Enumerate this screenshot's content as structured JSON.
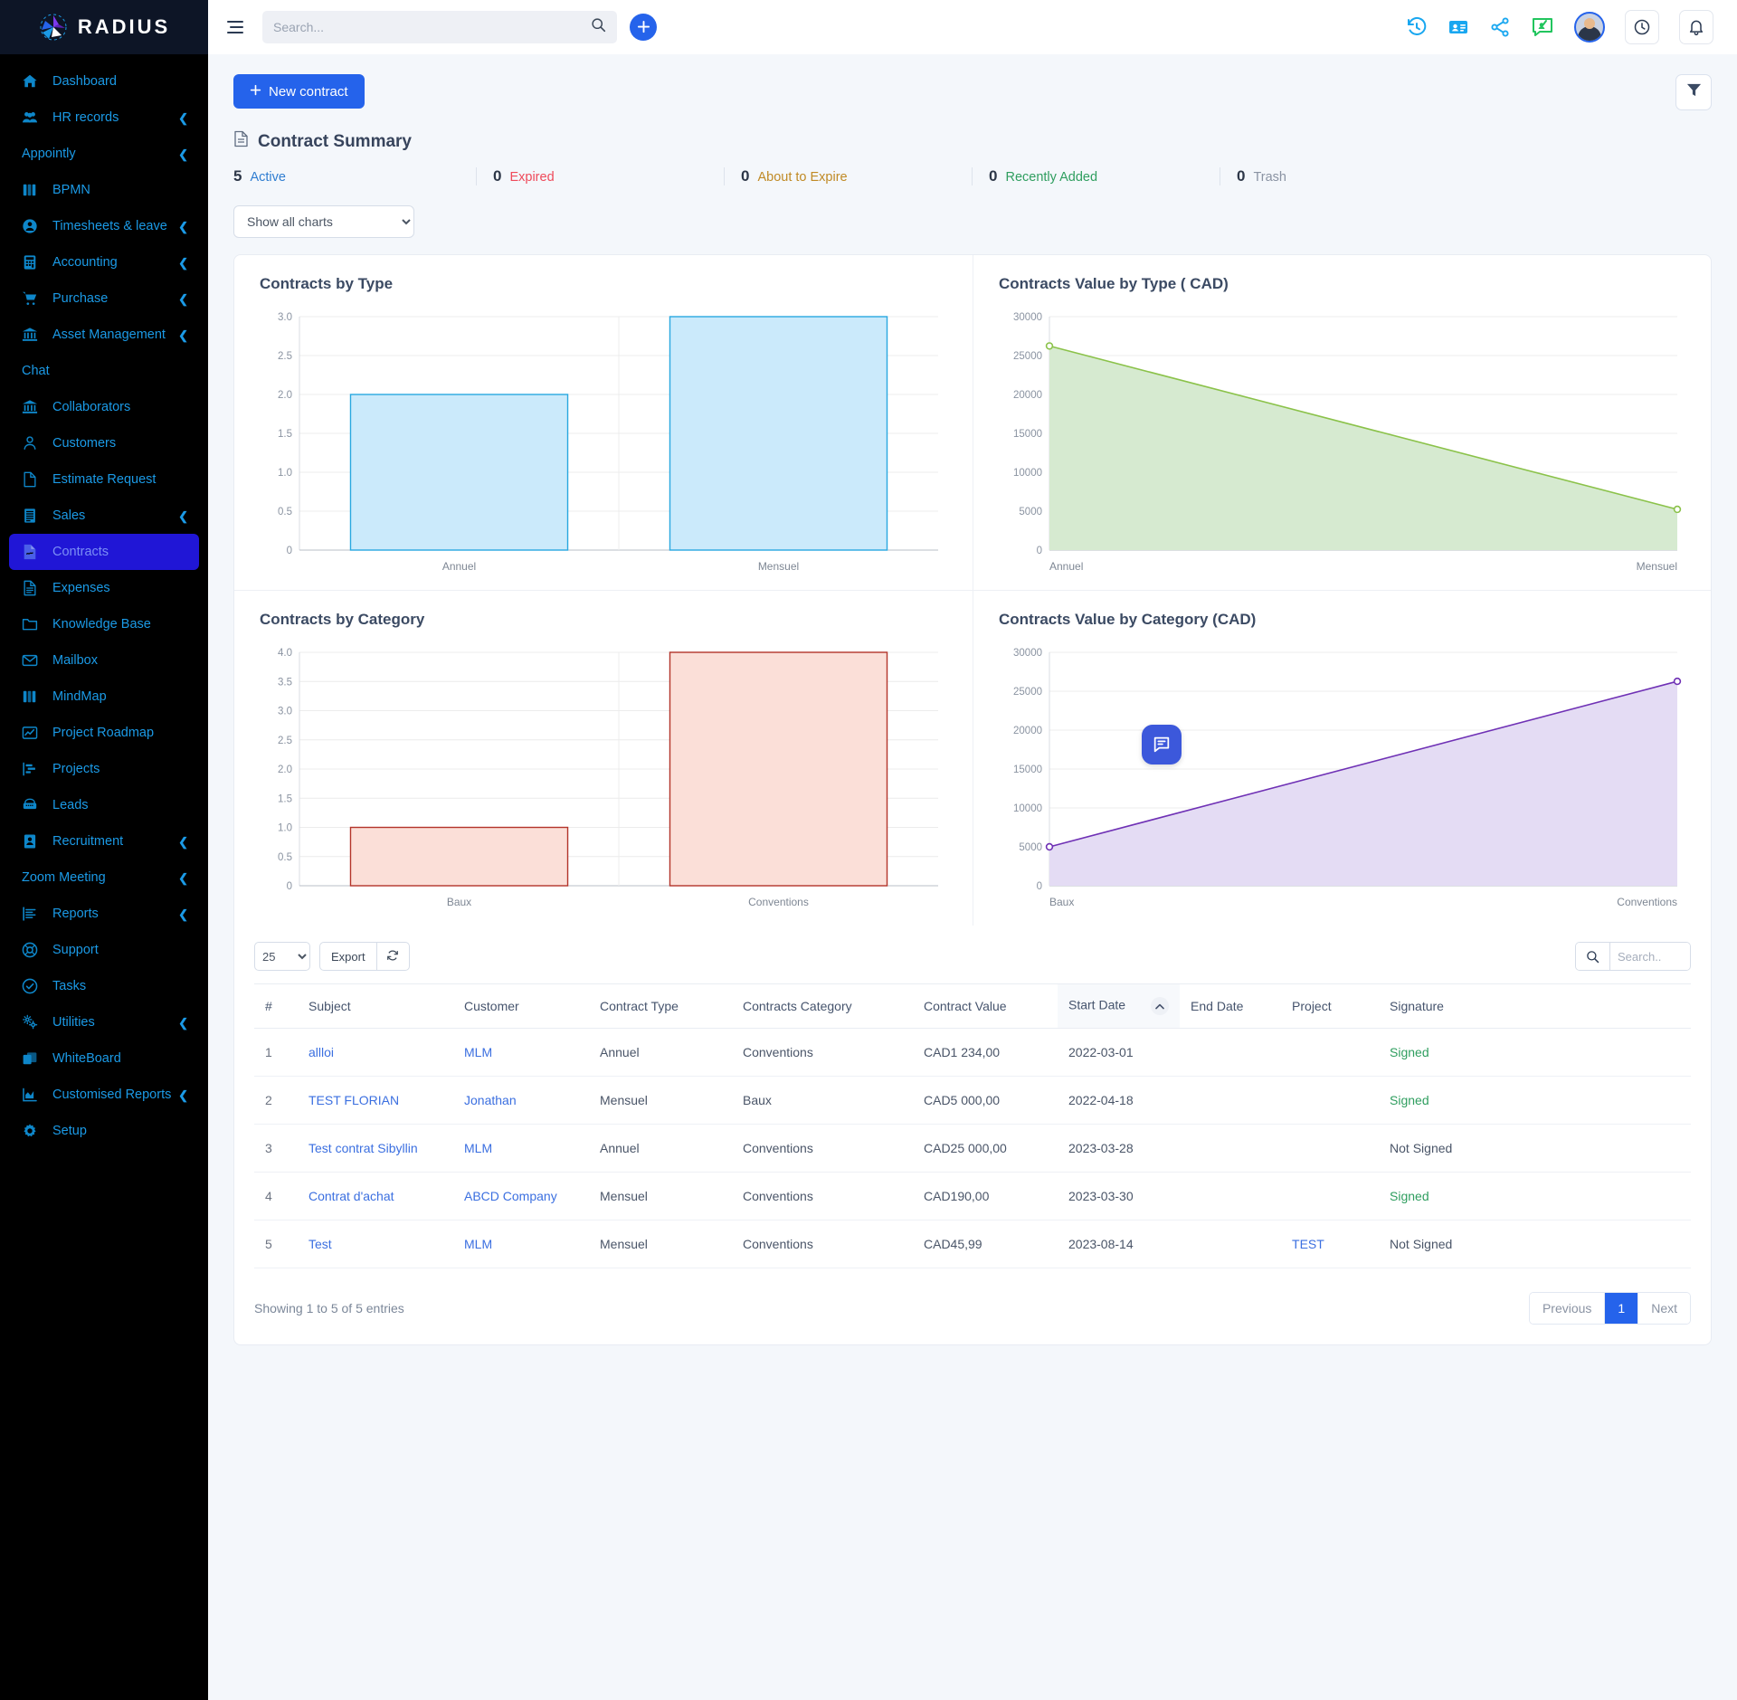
{
  "brand": {
    "name": "RADIUS"
  },
  "topbar": {
    "search_placeholder": "Search...",
    "menu_icon": "hamburger-icon",
    "search_icon": "search-icon",
    "add_icon": "plus-icon",
    "icons": [
      "history-icon",
      "contact-card-icon",
      "share-icon",
      "chat-check-icon"
    ],
    "clock_icon": "clock-icon",
    "bell_icon": "bell-icon"
  },
  "sidebar": {
    "items": [
      {
        "label": "Dashboard",
        "icon": "home-icon",
        "chevron": false,
        "active": false
      },
      {
        "label": "HR records",
        "icon": "users-icon",
        "chevron": true,
        "active": false
      },
      {
        "label": "Appointly",
        "icon": "",
        "chevron": true,
        "active": false
      },
      {
        "label": "BPMN",
        "icon": "book-icon",
        "chevron": false,
        "active": false
      },
      {
        "label": "Timesheets & leave",
        "icon": "user-circle-icon",
        "chevron": true,
        "active": false
      },
      {
        "label": "Accounting",
        "icon": "calculator-icon",
        "chevron": true,
        "active": false
      },
      {
        "label": "Purchase",
        "icon": "cart-icon",
        "chevron": true,
        "active": false
      },
      {
        "label": "Asset Management",
        "icon": "bank-icon",
        "chevron": true,
        "active": false
      },
      {
        "label": "Chat",
        "icon": "",
        "chevron": false,
        "active": false
      },
      {
        "label": "Collaborators",
        "icon": "bank-icon",
        "chevron": false,
        "active": false
      },
      {
        "label": "Customers",
        "icon": "person-icon",
        "chevron": false,
        "active": false
      },
      {
        "label": "Estimate Request",
        "icon": "file-icon",
        "chevron": false,
        "active": false
      },
      {
        "label": "Sales",
        "icon": "receipt-icon",
        "chevron": true,
        "active": false
      },
      {
        "label": "Contracts",
        "icon": "contract-icon",
        "chevron": false,
        "active": true
      },
      {
        "label": "Expenses",
        "icon": "doc-lines-icon",
        "chevron": false,
        "active": false
      },
      {
        "label": "Knowledge Base",
        "icon": "folder-icon",
        "chevron": false,
        "active": false
      },
      {
        "label": "Mailbox",
        "icon": "mail-icon",
        "chevron": false,
        "active": false
      },
      {
        "label": "MindMap",
        "icon": "book-icon",
        "chevron": false,
        "active": false
      },
      {
        "label": "Project Roadmap",
        "icon": "line-chart-icon",
        "chevron": false,
        "active": false
      },
      {
        "label": "Projects",
        "icon": "gantt-icon",
        "chevron": false,
        "active": false
      },
      {
        "label": "Leads",
        "icon": "phone-icon",
        "chevron": false,
        "active": false
      },
      {
        "label": "Recruitment",
        "icon": "id-badge-icon",
        "chevron": true,
        "active": false
      },
      {
        "label": "Zoom Meeting",
        "icon": "",
        "chevron": true,
        "active": false
      },
      {
        "label": "Reports",
        "icon": "report-icon",
        "chevron": true,
        "active": false
      },
      {
        "label": "Support",
        "icon": "lifebuoy-icon",
        "chevron": false,
        "active": false
      },
      {
        "label": "Tasks",
        "icon": "check-circle-icon",
        "chevron": false,
        "active": false
      },
      {
        "label": "Utilities",
        "icon": "gears-icon",
        "chevron": true,
        "active": false
      },
      {
        "label": "WhiteBoard",
        "icon": "layers-icon",
        "chevron": false,
        "active": false
      },
      {
        "label": "Customised Reports",
        "icon": "area-chart-icon",
        "chevron": true,
        "active": false
      },
      {
        "label": "Setup",
        "icon": "gear-icon",
        "chevron": false,
        "active": false
      }
    ]
  },
  "page": {
    "new_contract_label": "New contract",
    "filter_icon": "filter-icon",
    "summary_title": "Contract Summary",
    "summary_icon": "document-icon",
    "summary": [
      {
        "count": "5",
        "label": "Active",
        "color": "#2f7dd1"
      },
      {
        "count": "0",
        "label": "Expired",
        "color": "#ef4a5a"
      },
      {
        "count": "0",
        "label": "About to Expire",
        "color": "#c08a25"
      },
      {
        "count": "0",
        "label": "Recently Added",
        "color": "#2f9e5f"
      },
      {
        "count": "0",
        "label": "Trash",
        "color": "#8a93a3"
      }
    ],
    "chart_filter_value": "Show all charts",
    "chart_filter_options": [
      "Show all charts"
    ]
  },
  "chart_data": [
    {
      "type": "bar",
      "title": "Contracts by Type",
      "categories": [
        "Annuel",
        "Mensuel"
      ],
      "values": [
        2.0,
        3.0
      ],
      "ylim": [
        0,
        3.0
      ],
      "yticks": [
        "0",
        "0.5",
        "1.0",
        "1.5",
        "2.0",
        "2.5",
        "3.0"
      ],
      "ytick_values": [
        0,
        0.5,
        1.0,
        1.5,
        2.0,
        2.5,
        3.0
      ],
      "xlabel": "",
      "ylabel": "",
      "grid": true,
      "fill": "#cbeafb",
      "stroke": "#29a8e0"
    },
    {
      "type": "area",
      "title": "Contracts Value by Type ( CAD)",
      "categories": [
        "Annuel",
        "Mensuel"
      ],
      "values": [
        26234,
        5235
      ],
      "ylim": [
        0,
        30000
      ],
      "yticks": [
        "0",
        "5000",
        "10000",
        "15000",
        "20000",
        "25000",
        "30000"
      ],
      "ytick_values": [
        0,
        5000,
        10000,
        15000,
        20000,
        25000,
        30000
      ],
      "xlabel": "",
      "ylabel": "",
      "grid": true,
      "fill": "#d6ead0",
      "stroke": "#8bc24a"
    },
    {
      "type": "bar",
      "title": "Contracts by Category",
      "categories": [
        "Baux",
        "Conventions"
      ],
      "values": [
        1.0,
        4.0
      ],
      "ylim": [
        0,
        4.0
      ],
      "yticks": [
        "0",
        "0.5",
        "1.0",
        "1.5",
        "2.0",
        "2.5",
        "3.0",
        "3.5",
        "4.0"
      ],
      "ytick_values": [
        0,
        0.5,
        1.0,
        1.5,
        2.0,
        2.5,
        3.0,
        3.5,
        4.0
      ],
      "xlabel": "",
      "ylabel": "",
      "grid": true,
      "fill": "#fbdfd8",
      "stroke": "#b3342a"
    },
    {
      "type": "area",
      "title": "Contracts Value by Category (CAD)",
      "categories": [
        "Baux",
        "Conventions"
      ],
      "values": [
        5000,
        26270
      ],
      "ylim": [
        0,
        30000
      ],
      "yticks": [
        "0",
        "5000",
        "10000",
        "15000",
        "20000",
        "25000",
        "30000"
      ],
      "ytick_values": [
        0,
        5000,
        10000,
        15000,
        20000,
        25000,
        30000
      ],
      "xlabel": "",
      "ylabel": "",
      "grid": true,
      "fill": "#e4dcf4",
      "stroke": "#6f31b5"
    }
  ],
  "table": {
    "page_length": "25",
    "page_length_options": [
      "25"
    ],
    "export_label": "Export",
    "refresh_icon": "refresh-icon",
    "search_icon": "search-icon",
    "search_placeholder": "Search..",
    "sort_icon": "chevron-up-icon",
    "columns": [
      "#",
      "Subject",
      "Customer",
      "Contract Type",
      "Contracts Category",
      "Contract Value",
      "Start Date",
      "End Date",
      "Project",
      "Signature"
    ],
    "sorted_column": "Start Date",
    "rows": [
      {
        "num": "1",
        "subject": "allloi",
        "customer": "MLM",
        "type": "Annuel",
        "category": "Conventions",
        "value": "CAD1 234,00",
        "start": "2022-03-01",
        "end": "",
        "project": "",
        "signature": "Signed",
        "signed": true
      },
      {
        "num": "2",
        "subject": "TEST FLORIAN",
        "customer": "Jonathan",
        "type": "Mensuel",
        "category": "Baux",
        "value": "CAD5 000,00",
        "start": "2022-04-18",
        "end": "",
        "project": "",
        "signature": "Signed",
        "signed": true
      },
      {
        "num": "3",
        "subject": "Test contrat Sibyllin",
        "customer": "MLM",
        "type": "Annuel",
        "category": "Conventions",
        "value": "CAD25 000,00",
        "start": "2023-03-28",
        "end": "",
        "project": "",
        "signature": "Not Signed",
        "signed": false
      },
      {
        "num": "4",
        "subject": "Contrat d'achat",
        "customer": "ABCD Company",
        "type": "Mensuel",
        "category": "Conventions",
        "value": "CAD190,00",
        "start": "2023-03-30",
        "end": "",
        "project": "",
        "signature": "Signed",
        "signed": true
      },
      {
        "num": "5",
        "subject": "Test",
        "customer": "MLM",
        "type": "Mensuel",
        "category": "Conventions",
        "value": "CAD45,99",
        "start": "2023-08-14",
        "end": "",
        "project": "TEST",
        "signature": "Not Signed",
        "signed": false
      }
    ],
    "entries_info": "Showing 1 to 5 of 5 entries",
    "pagination": {
      "previous": "Previous",
      "current": "1",
      "next": "Next"
    }
  },
  "chat_fab": {
    "icon": "chat-icon"
  }
}
